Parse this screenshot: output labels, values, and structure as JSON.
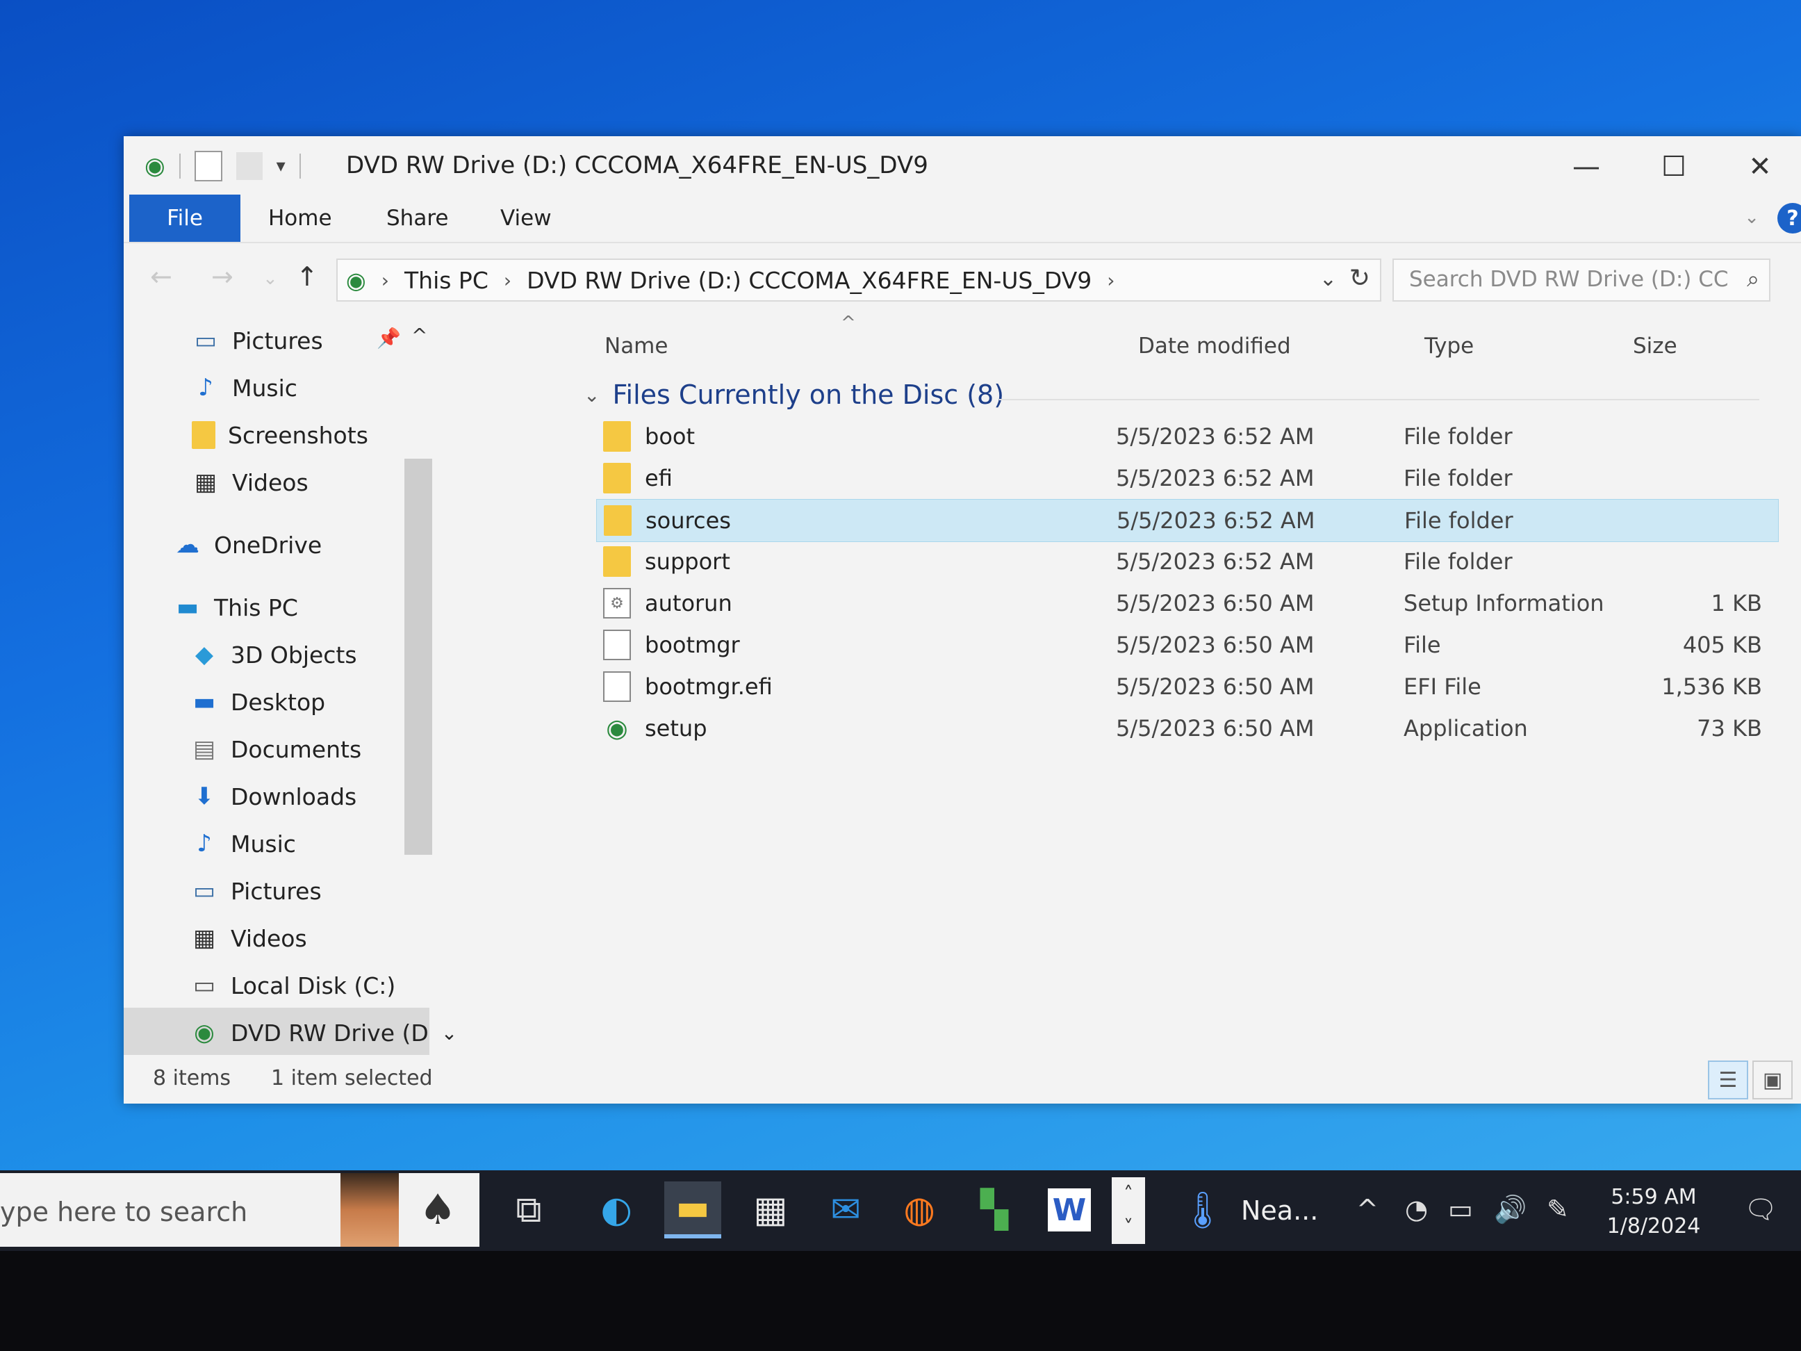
{
  "window": {
    "title": "DVD RW Drive (D:) CCCOMA_X64FRE_EN-US_DV9",
    "controls": {
      "minimize": "—",
      "maximize": "☐",
      "close": "✕"
    }
  },
  "ribbon": {
    "tabs": [
      "File",
      "Home",
      "Share",
      "View"
    ],
    "help": "?"
  },
  "address": {
    "crumbs": [
      "This PC",
      "DVD RW Drive (D:) CCCOMA_X64FRE_EN-US_DV9"
    ],
    "search_placeholder": "Search DVD RW Drive (D:) CC..."
  },
  "sidebar": {
    "items": [
      {
        "label": "Pictures",
        "icon": "pictures-icon",
        "glyph": "▭"
      },
      {
        "label": "Music",
        "icon": "music-icon",
        "glyph": "♪"
      },
      {
        "label": "Screenshots",
        "icon": "folder-icon",
        "glyph": ""
      },
      {
        "label": "Videos",
        "icon": "videos-icon",
        "glyph": "▦"
      },
      {
        "label": "OneDrive",
        "icon": "cloud-icon",
        "glyph": "☁"
      },
      {
        "label": "This PC",
        "icon": "computer-icon",
        "glyph": "▬"
      },
      {
        "label": "3D Objects",
        "icon": "cube-icon",
        "glyph": "◆"
      },
      {
        "label": "Desktop",
        "icon": "desktop-icon",
        "glyph": "▬"
      },
      {
        "label": "Documents",
        "icon": "documents-icon",
        "glyph": "▤"
      },
      {
        "label": "Downloads",
        "icon": "download-icon",
        "glyph": "⬇"
      },
      {
        "label": "Music",
        "icon": "music-icon",
        "glyph": "♪"
      },
      {
        "label": "Pictures",
        "icon": "pictures-icon",
        "glyph": "▭"
      },
      {
        "label": "Videos",
        "icon": "videos-icon",
        "glyph": "▦"
      },
      {
        "label": "Local Disk (C:)",
        "icon": "disk-icon",
        "glyph": "▭"
      },
      {
        "label": "DVD RW Drive (D",
        "icon": "dvd-drive-icon",
        "glyph": "◉"
      }
    ]
  },
  "columns": {
    "name": "Name",
    "date": "Date modified",
    "type": "Type",
    "size": "Size"
  },
  "group": {
    "label": "Files Currently on the Disc (8)"
  },
  "files": [
    {
      "name": "boot",
      "date": "5/5/2023 6:52 AM",
      "type": "File folder",
      "size": "",
      "kind": "folder"
    },
    {
      "name": "efi",
      "date": "5/5/2023 6:52 AM",
      "type": "File folder",
      "size": "",
      "kind": "folder"
    },
    {
      "name": "sources",
      "date": "5/5/2023 6:52 AM",
      "type": "File folder",
      "size": "",
      "kind": "folder"
    },
    {
      "name": "support",
      "date": "5/5/2023 6:52 AM",
      "type": "File folder",
      "size": "",
      "kind": "folder"
    },
    {
      "name": "autorun",
      "date": "5/5/2023 6:50 AM",
      "type": "Setup Information",
      "size": "1 KB",
      "kind": "setupinfo"
    },
    {
      "name": "bootmgr",
      "date": "5/5/2023 6:50 AM",
      "type": "File",
      "size": "405 KB",
      "kind": "file"
    },
    {
      "name": "bootmgr.efi",
      "date": "5/5/2023 6:50 AM",
      "type": "EFI File",
      "size": "1,536 KB",
      "kind": "file"
    },
    {
      "name": "setup",
      "date": "5/5/2023 6:50 AM",
      "type": "Application",
      "size": "73 KB",
      "kind": "app"
    }
  ],
  "status": {
    "count": "8 items",
    "selection": "1 item selected"
  },
  "taskbar": {
    "search_placeholder": "ype here to search",
    "weather": "Nea...",
    "time": "5:59 AM",
    "date": "1/8/2024"
  },
  "colors": {
    "accent": "#1c63c9",
    "selection": "#cde8f5",
    "folder": "#f5c842"
  }
}
